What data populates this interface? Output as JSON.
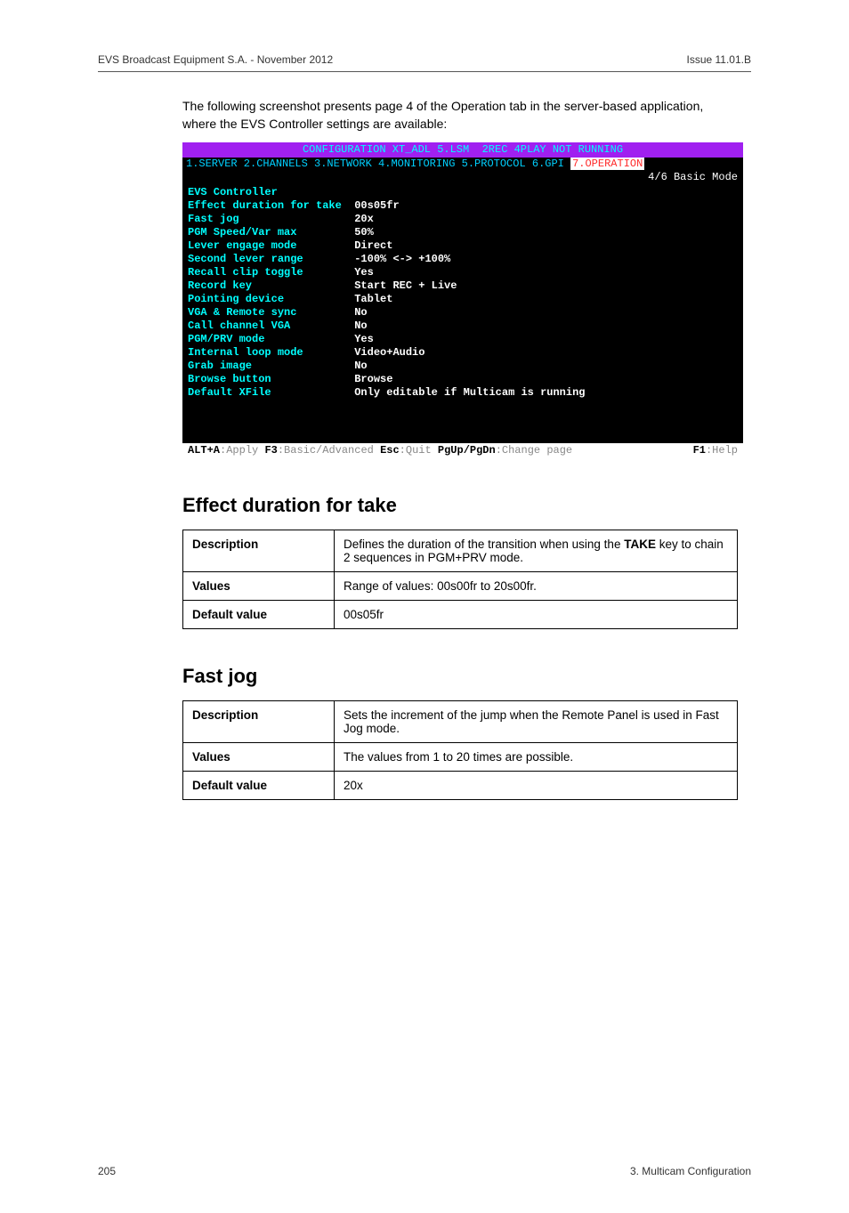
{
  "header": {
    "left": "EVS Broadcast Equipment S.A. - November 2012",
    "right": "Issue 11.01.B"
  },
  "intro": "The following screenshot presents page 4 of the Operation tab in the server-based application, where the EVS Controller settings are available:",
  "terminal": {
    "titlebar": "CONFIGURATION XT_ADL 5.LSM  2REC 4PLAY NOT RUNNING",
    "tabs_prefix": "1.SERVER 2.CHANNELS 3.NETWORK 4.MONITORING 5.PROTOCOL 6.GPI ",
    "tabs_active": "7.OPERATION",
    "mode": "4/6 Basic Mode",
    "section_heading": "EVS Controller",
    "settings": [
      {
        "k": "Effect duration for take",
        "v": "00s05fr"
      },
      {
        "k": "Fast jog",
        "v": "20x"
      },
      {
        "k": "PGM Speed/Var max",
        "v": "50%"
      },
      {
        "k": "Lever engage mode",
        "v": "Direct"
      },
      {
        "k": "Second lever range",
        "v": "-100% <-> +100%"
      },
      {
        "k": "Recall clip toggle",
        "v": "Yes"
      },
      {
        "k": "Record key",
        "v": "Start REC + Live"
      },
      {
        "k": "Pointing device",
        "v": "Tablet"
      },
      {
        "k": "VGA & Remote sync",
        "v": "No"
      },
      {
        "k": "Call channel VGA",
        "v": "No"
      },
      {
        "k": "PGM/PRV mode",
        "v": "Yes"
      },
      {
        "k": "Internal loop mode",
        "v": "Video+Audio"
      },
      {
        "k": "Grab image",
        "v": "No"
      },
      {
        "k": "Browse button",
        "v": "Browse"
      },
      {
        "k": "Default XFile",
        "v": "Only editable if Multicam is running"
      }
    ],
    "footer": {
      "k1": "ALT+A",
      "t1": ":Apply ",
      "k2": "F3",
      "t2": ":Basic/Advanced ",
      "k3": "Esc",
      "t3": ":Quit ",
      "k4": "PgUp/PgDn",
      "t4": ":Change page",
      "k5": "F1",
      "t5": ":Help"
    }
  },
  "sections": [
    {
      "title": "Effect duration for take",
      "rows": {
        "Description": "Defines the duration of the transition when using the TAKE key to chain 2 sequences in PGM+PRV mode.",
        "Values": "Range of values: 00s00fr to 20s00fr.",
        "Default value": "00s05fr"
      }
    },
    {
      "title": "Fast jog",
      "rows": {
        "Description": "Sets the increment of the jump when the Remote Panel is used in Fast Jog mode.",
        "Values": "The values from 1 to 20 times are possible.",
        "Default value": "20x"
      }
    }
  ],
  "row_labels": {
    "desc": "Description",
    "values": "Values",
    "default": "Default value"
  },
  "footer": {
    "left": "205",
    "right": "3. Multicam Configuration"
  }
}
